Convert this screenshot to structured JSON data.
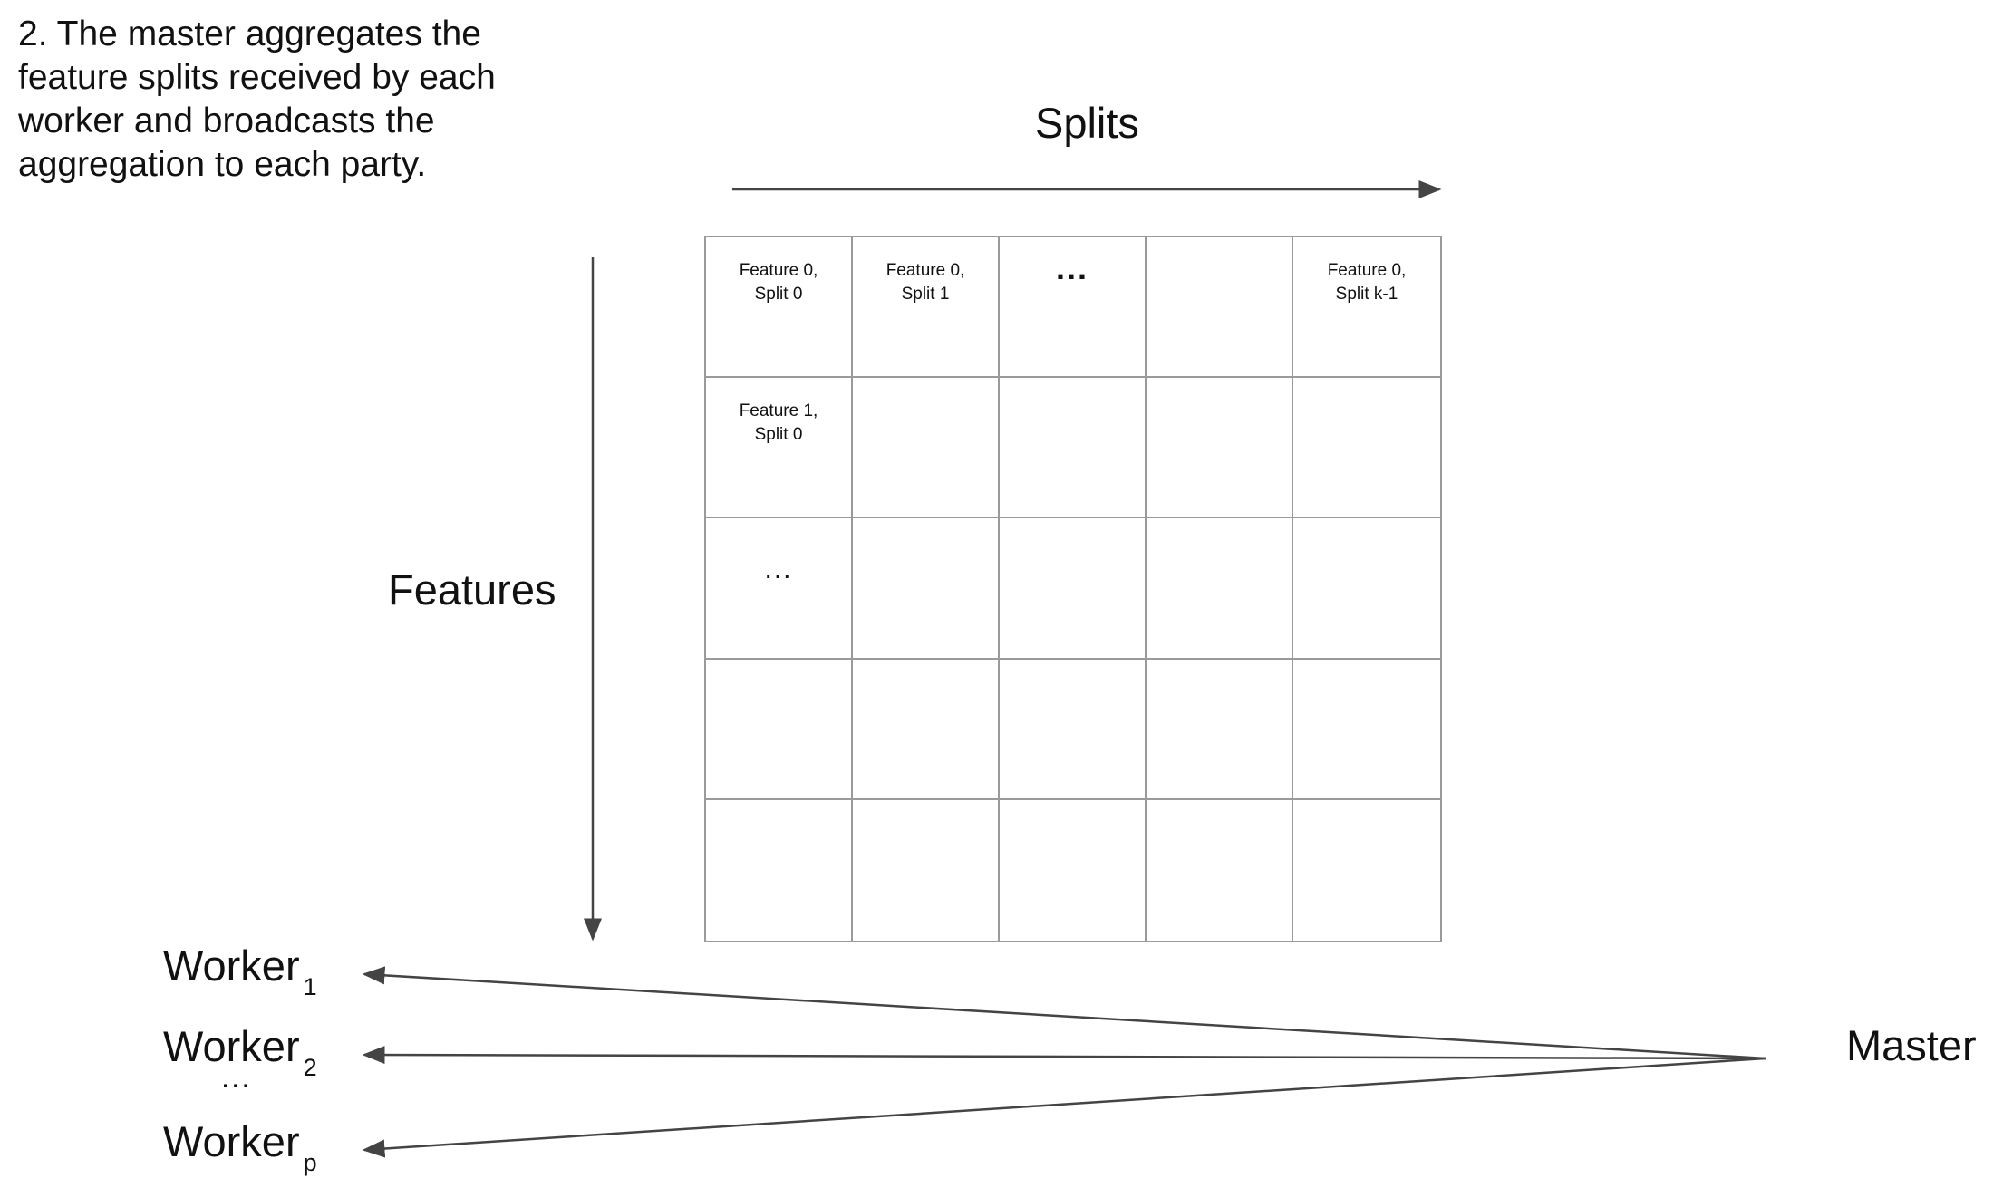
{
  "caption": "2. The master aggregates the\nfeature splits received by each\nworker and broadcasts the\naggregation to each party.",
  "axes": {
    "splits_label": "Splits",
    "features_label": "Features"
  },
  "grid": {
    "rows": 5,
    "cols": 5,
    "cells": [
      [
        "Feature 0,\nSplit 0",
        "Feature 0,\nSplit 1",
        "...",
        "",
        "Feature 0,\nSplit k-1"
      ],
      [
        "Feature 1,\nSplit 0",
        "",
        "",
        "",
        ""
      ],
      [
        "...",
        "",
        "",
        "",
        ""
      ],
      [
        "",
        "",
        "",
        "",
        ""
      ],
      [
        "",
        "",
        "",
        "",
        ""
      ]
    ]
  },
  "workers": [
    {
      "name": "Worker",
      "subscript": "1"
    },
    {
      "name": "Worker",
      "subscript": "2"
    },
    {
      "name": "Worker",
      "subscript": "p"
    }
  ],
  "workers_ellipsis": "...",
  "master_label": "Master",
  "colors": {
    "arrow": "#444444",
    "grid_line": "#9a9a9a",
    "text": "#111111"
  }
}
